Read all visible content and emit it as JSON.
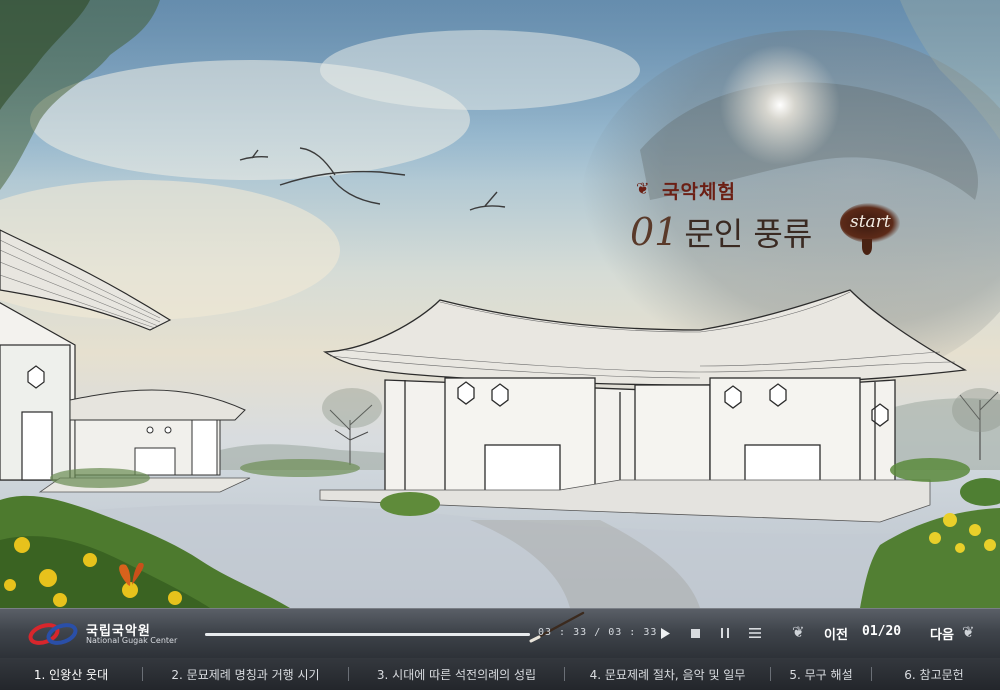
{
  "lesson": {
    "subtitle": "국악체험",
    "number": "01",
    "title": "문인 풍류",
    "start_label": "start"
  },
  "logo": {
    "name_ko": "국립국악원",
    "name_en": "National Gugak Center"
  },
  "player": {
    "progress": 1.0,
    "time_current": "03 : 33",
    "time_separator": "/",
    "time_total": "03 : 33",
    "controls": [
      "play-icon",
      "stop-icon",
      "pause-icon",
      "menu-icon"
    ]
  },
  "pager": {
    "prev_label": "이전",
    "page_label": "01/20",
    "next_label": "다음"
  },
  "chapters": [
    {
      "label": "1. 인왕산 웃대"
    },
    {
      "label": "2. 문묘제례 명칭과 거행 시기"
    },
    {
      "label": "3. 시대에 따른 석전의례의 성립"
    },
    {
      "label": "4. 문묘제례 절차, 음악 및 일무"
    },
    {
      "label": "5. 무구 해설"
    },
    {
      "label": "6. 참고문헌"
    }
  ],
  "colors": {
    "title_ink": "#6b1f14",
    "bar_dark": "#2d3137",
    "logo_red": "#d8262c",
    "logo_blue": "#2a4fa8"
  }
}
